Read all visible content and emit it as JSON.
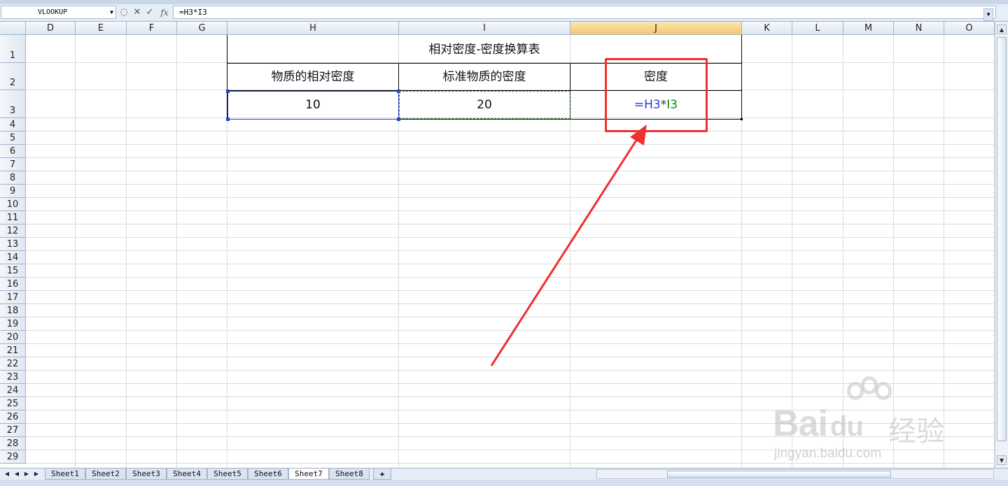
{
  "formula_bar": {
    "name_box": "VLOOKUP",
    "cancel_glyph": "✕",
    "enter_glyph": "✓",
    "fx_label": "fx",
    "formula": "=H3*I3"
  },
  "columns": [
    "D",
    "E",
    "F",
    "G",
    "H",
    "I",
    "J",
    "K",
    "L",
    "M",
    "N",
    "O"
  ],
  "selected_column": "J",
  "rows": [
    "1",
    "2",
    "3",
    "4",
    "5",
    "6",
    "7",
    "8",
    "9",
    "10",
    "11",
    "12",
    "13",
    "14",
    "15",
    "16",
    "17",
    "18",
    "19",
    "20",
    "21",
    "22",
    "23",
    "24",
    "25",
    "26",
    "27",
    "28",
    "29"
  ],
  "table": {
    "title": "相对密度-密度换算表",
    "headers": [
      "物质的相对密度",
      "标准物质的密度",
      "密度"
    ],
    "values": [
      "10",
      "20"
    ],
    "formula_eq": "=",
    "formula_ref1": "H3",
    "formula_op": "*",
    "formula_ref2": "I3"
  },
  "sheet_tabs": [
    "Sheet1",
    "Sheet2",
    "Sheet3",
    "Sheet4",
    "Sheet5",
    "Sheet6",
    "Sheet7",
    "Sheet8"
  ],
  "active_sheet": "Sheet7",
  "watermark": {
    "main": "Bai",
    "main2": "du",
    "cn": "经验",
    "sub": "jingyan.baidu.com"
  },
  "colors": {
    "ref1": "#1f3fd6",
    "ref2": "#0a8a0a",
    "annotation": "#f03030",
    "selected_header": "#f5c66b"
  }
}
